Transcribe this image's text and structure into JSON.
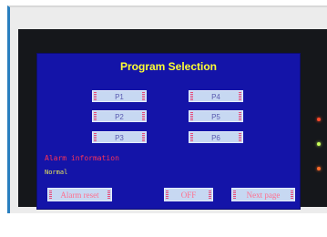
{
  "screen": {
    "title": "Program Selection",
    "programs": [
      "P1",
      "P2",
      "P3",
      "P4",
      "P5",
      "P6"
    ],
    "alarm_label": "Alarm information",
    "alarm_status": "Normal",
    "buttons": {
      "alarm_reset": "Alarm reset",
      "off": "OFF",
      "next_page": "Next page"
    }
  },
  "colors": {
    "screen_bg": "#1414a8",
    "title": "#ffff33",
    "alarm_label": "#ff3355",
    "alarm_status": "#e8e85a",
    "button_face": "#c7d8f2",
    "button_text": "#ff6f8f",
    "frame_accent": "#2a7fbf",
    "bezel": "#15171b"
  },
  "indicators": [
    {
      "name": "power-led",
      "color": "#ff4a2a"
    },
    {
      "name": "run-led",
      "color": "#c8ff5a"
    },
    {
      "name": "alarm-led",
      "color": "#ff6a2a"
    }
  ]
}
